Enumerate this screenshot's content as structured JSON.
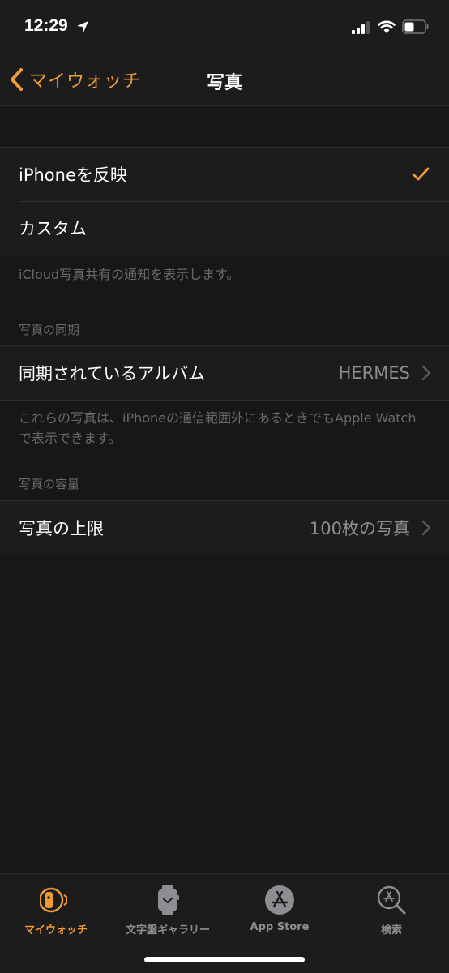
{
  "status_bar": {
    "time": "12:29",
    "location_icon": "location-arrow-icon",
    "signal_icon": "cellular-signal-icon",
    "wifi_icon": "wifi-icon",
    "battery_icon": "battery-icon"
  },
  "nav": {
    "back_label": "マイウォッチ",
    "title": "写真"
  },
  "colors": {
    "accent": "#f09a36",
    "background": "#171717",
    "cell_background": "#1c1c1c",
    "secondary_text": "#8e8e92",
    "footer_text": "#6a6a6e"
  },
  "mirror_group": {
    "rows": [
      {
        "label": "iPhoneを反映",
        "selected": true
      },
      {
        "label": "カスタム",
        "selected": false
      }
    ],
    "footer": "iCloud写真共有の通知を表示します。"
  },
  "sync_section": {
    "header": "写真の同期",
    "row": {
      "label": "同期されているアルバム",
      "value": "HERMES"
    },
    "footer": "これらの写真は、iPhoneの通信範囲外にあるときでもApple Watchで表示できます。"
  },
  "capacity_section": {
    "header": "写真の容量",
    "row": {
      "label": "写真の上限",
      "value": "100枚の写真"
    }
  },
  "tab_bar": {
    "tabs": [
      {
        "label": "マイウォッチ",
        "icon": "watch-icon",
        "active": true
      },
      {
        "label": "文字盤ギャラリー",
        "icon": "watch-face-icon",
        "active": false
      },
      {
        "label": "App Store",
        "icon": "app-store-icon",
        "active": false
      },
      {
        "label": "検索",
        "icon": "search-icon",
        "active": false
      }
    ]
  }
}
